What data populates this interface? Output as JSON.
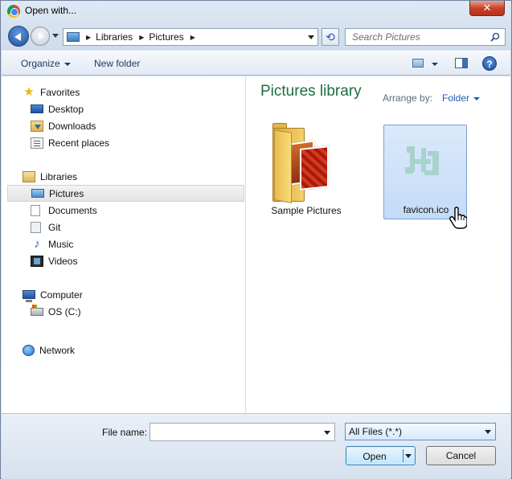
{
  "window": {
    "title": "Open with...",
    "close_glyph": "✕"
  },
  "address": {
    "crumbs": [
      "Libraries",
      "Pictures"
    ]
  },
  "search": {
    "placeholder": "Search Pictures"
  },
  "toolbar": {
    "organize_label": "Organize",
    "new_folder_label": "New folder",
    "help_glyph": "?"
  },
  "sidebar": {
    "favorites": {
      "label": "Favorites",
      "items": [
        "Desktop",
        "Downloads",
        "Recent places"
      ]
    },
    "libraries": {
      "label": "Libraries",
      "items": [
        "Pictures",
        "Documents",
        "Git",
        "Music",
        "Videos"
      ],
      "selected": "Pictures"
    },
    "computer": {
      "label": "Computer",
      "items": [
        "OS (C:)"
      ]
    },
    "network": {
      "label": "Network"
    }
  },
  "main": {
    "title": "Pictures library",
    "arrange_label": "Arrange by:",
    "arrange_value": "Folder",
    "files": [
      {
        "name": "Sample Pictures",
        "icon": "folder-icon"
      },
      {
        "name": "favicon.ico",
        "icon": "ico-file-icon",
        "selected": true
      }
    ]
  },
  "bottom": {
    "file_name_label": "File name:",
    "file_name_value": "",
    "filter_value": "All Files (*.*)",
    "open_label": "Open",
    "cancel_label": "Cancel"
  },
  "colors": {
    "title_green": "#1e6e3e",
    "link_blue": "#1e5cb3",
    "close_red": "#c7432c",
    "selection": "#cce0f8"
  }
}
